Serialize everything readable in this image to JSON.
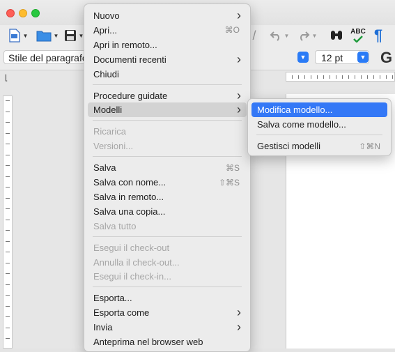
{
  "toolbar": {
    "icons": [
      "new-document-icon",
      "open-folder-icon",
      "save-icon",
      "undo-icon",
      "redo-icon",
      "find-icon",
      "spellcheck-icon",
      "formatting-marks-icon"
    ],
    "spell_label": "ABC"
  },
  "formatbar": {
    "paragraph_style": "Stile del paragrafo",
    "font_size": "12 pt",
    "bold_label": "G"
  },
  "file_menu": {
    "items": [
      {
        "label": "Nuovo",
        "submenu": true
      },
      {
        "label": "Apri...",
        "shortcut": "⌘O"
      },
      {
        "label": "Apri in remoto..."
      },
      {
        "label": "Documenti recenti",
        "submenu": true
      },
      {
        "label": "Chiudi"
      },
      {
        "label": "Procedure guidate",
        "submenu": true
      },
      {
        "label": "Modelli",
        "submenu": true,
        "state": "hover"
      },
      {
        "label": "Ricarica",
        "disabled": true
      },
      {
        "label": "Versioni...",
        "disabled": true
      },
      {
        "label": "Salva",
        "shortcut": "⌘S"
      },
      {
        "label": "Salva con nome...",
        "shortcut": "⇧⌘S"
      },
      {
        "label": "Salva in remoto..."
      },
      {
        "label": "Salva una copia..."
      },
      {
        "label": "Salva tutto",
        "disabled": true
      },
      {
        "label": "Esegui il check-out",
        "disabled": true
      },
      {
        "label": "Annulla il check-out...",
        "disabled": true
      },
      {
        "label": "Esegui il check-in...",
        "disabled": true
      },
      {
        "label": "Esporta..."
      },
      {
        "label": "Esporta come",
        "submenu": true
      },
      {
        "label": "Invia",
        "submenu": true
      },
      {
        "label": "Anteprima nel browser web"
      }
    ]
  },
  "templates_submenu": {
    "items": [
      {
        "label": "Modifica modello...",
        "state": "selected"
      },
      {
        "label": "Salva come modello..."
      },
      {
        "label": "Gestisci modelli",
        "shortcut": "⇧⌘N"
      }
    ]
  },
  "colors": {
    "accent": "#3478f6",
    "hover": "#d3d3d3",
    "disabled_text": "#a6a6a6"
  }
}
